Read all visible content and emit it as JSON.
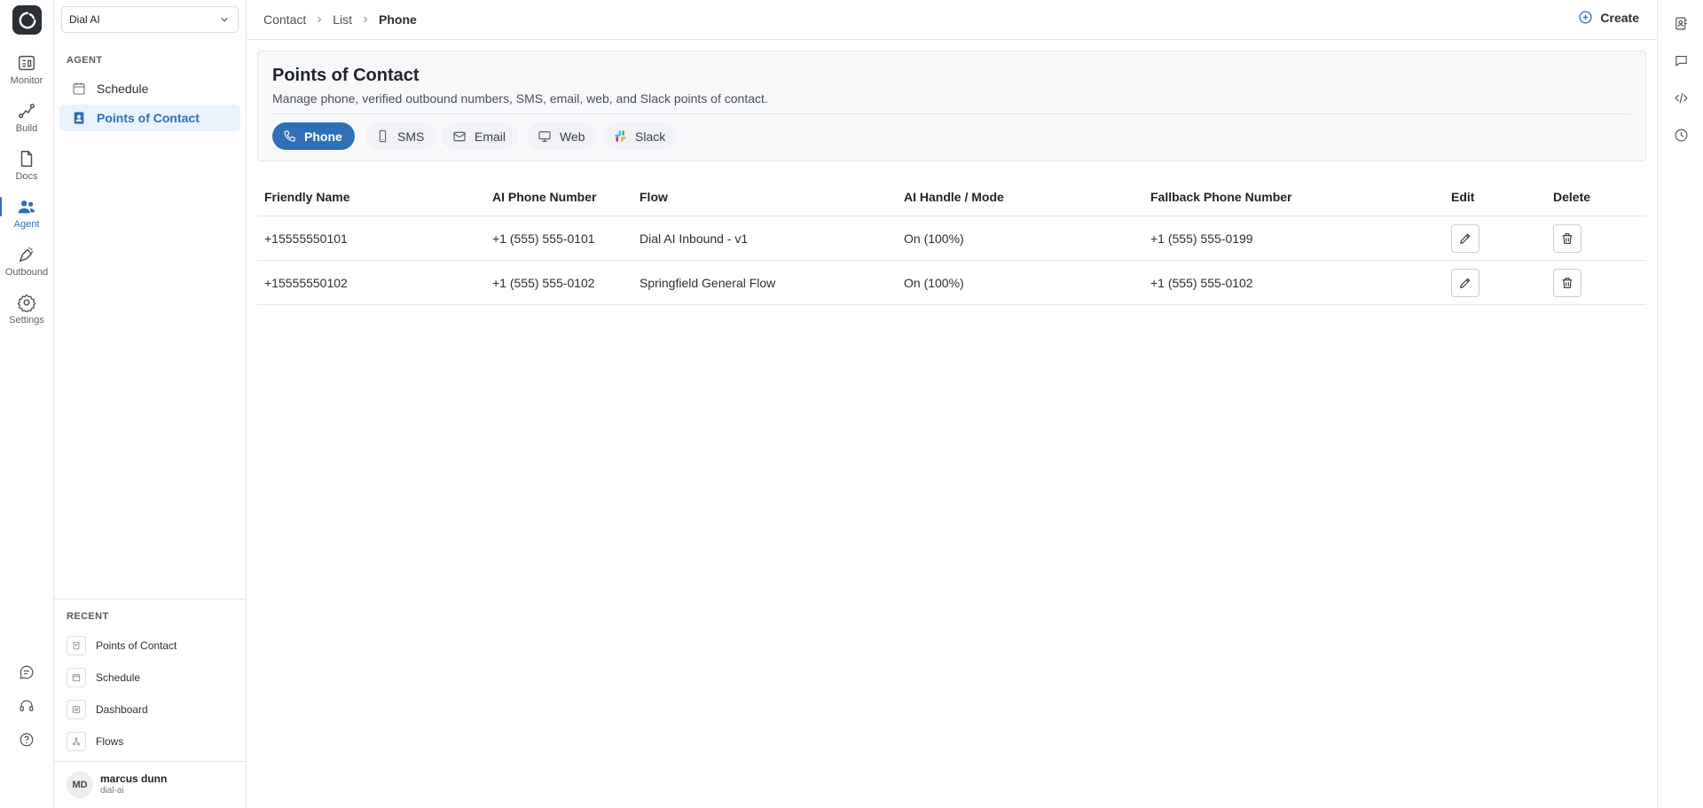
{
  "rail": {
    "items": [
      {
        "label": "Monitor",
        "icon": "monitor-icon"
      },
      {
        "label": "Build",
        "icon": "build-icon"
      },
      {
        "label": "Docs",
        "icon": "docs-icon"
      },
      {
        "label": "Agent",
        "icon": "agent-icon",
        "active": true
      },
      {
        "label": "Outbound",
        "icon": "outbound-icon"
      },
      {
        "label": "Settings",
        "icon": "gear-icon"
      }
    ],
    "bottom_icons": [
      "chat-icon",
      "headset-icon",
      "help-icon"
    ]
  },
  "sidebar": {
    "workspace": "Dial AI",
    "section_label": "AGENT",
    "items": [
      {
        "label": "Schedule",
        "icon": "calendar-icon"
      },
      {
        "label": "Points of Contact",
        "icon": "contact-book-icon",
        "active": true
      }
    ],
    "recent_label": "RECENT",
    "recent": [
      {
        "label": "Points of Contact"
      },
      {
        "label": "Schedule"
      },
      {
        "label": "Dashboard"
      },
      {
        "label": "Flows"
      }
    ],
    "user": {
      "initials": "MD",
      "name": "marcus dunn",
      "org": "dial-ai"
    }
  },
  "header": {
    "breadcrumbs": [
      "Contact",
      "List",
      "Phone"
    ],
    "create_label": "Create"
  },
  "utility_icons": [
    "contact-card-icon",
    "message-icon",
    "code-icon",
    "history-icon"
  ],
  "panel": {
    "title": "Points of Contact",
    "subtitle": "Manage phone, verified outbound numbers, SMS, email, web, and Slack points of contact.",
    "tabs": [
      {
        "label": "Phone",
        "icon": "phone-icon",
        "active": true
      },
      {
        "label": "SMS",
        "icon": "mobile-icon"
      },
      {
        "label": "Email",
        "icon": "mail-icon"
      },
      {
        "label": "Web",
        "icon": "desktop-icon"
      },
      {
        "label": "Slack",
        "icon": "slack-icon"
      }
    ]
  },
  "table": {
    "columns": [
      "Friendly Name",
      "AI Phone Number",
      "Flow",
      "AI Handle / Mode",
      "Fallback Phone Number",
      "Edit",
      "Delete"
    ],
    "rows": [
      {
        "friendly_name": "+15555550101",
        "ai_phone": "+1 (555) 555-0101",
        "flow": "Dial AI Inbound - v1",
        "mode": "On (100%)",
        "fallback": "+1 (555) 555-0199"
      },
      {
        "friendly_name": "+15555550102",
        "ai_phone": "+1 (555) 555-0102",
        "flow": "Springfield General Flow",
        "mode": "On (100%)",
        "fallback": "+1 (555) 555-0102"
      }
    ]
  },
  "colors": {
    "accent": "#2f6fb5",
    "active_bg": "#eaf2fb",
    "border": "#e4e6ea"
  }
}
